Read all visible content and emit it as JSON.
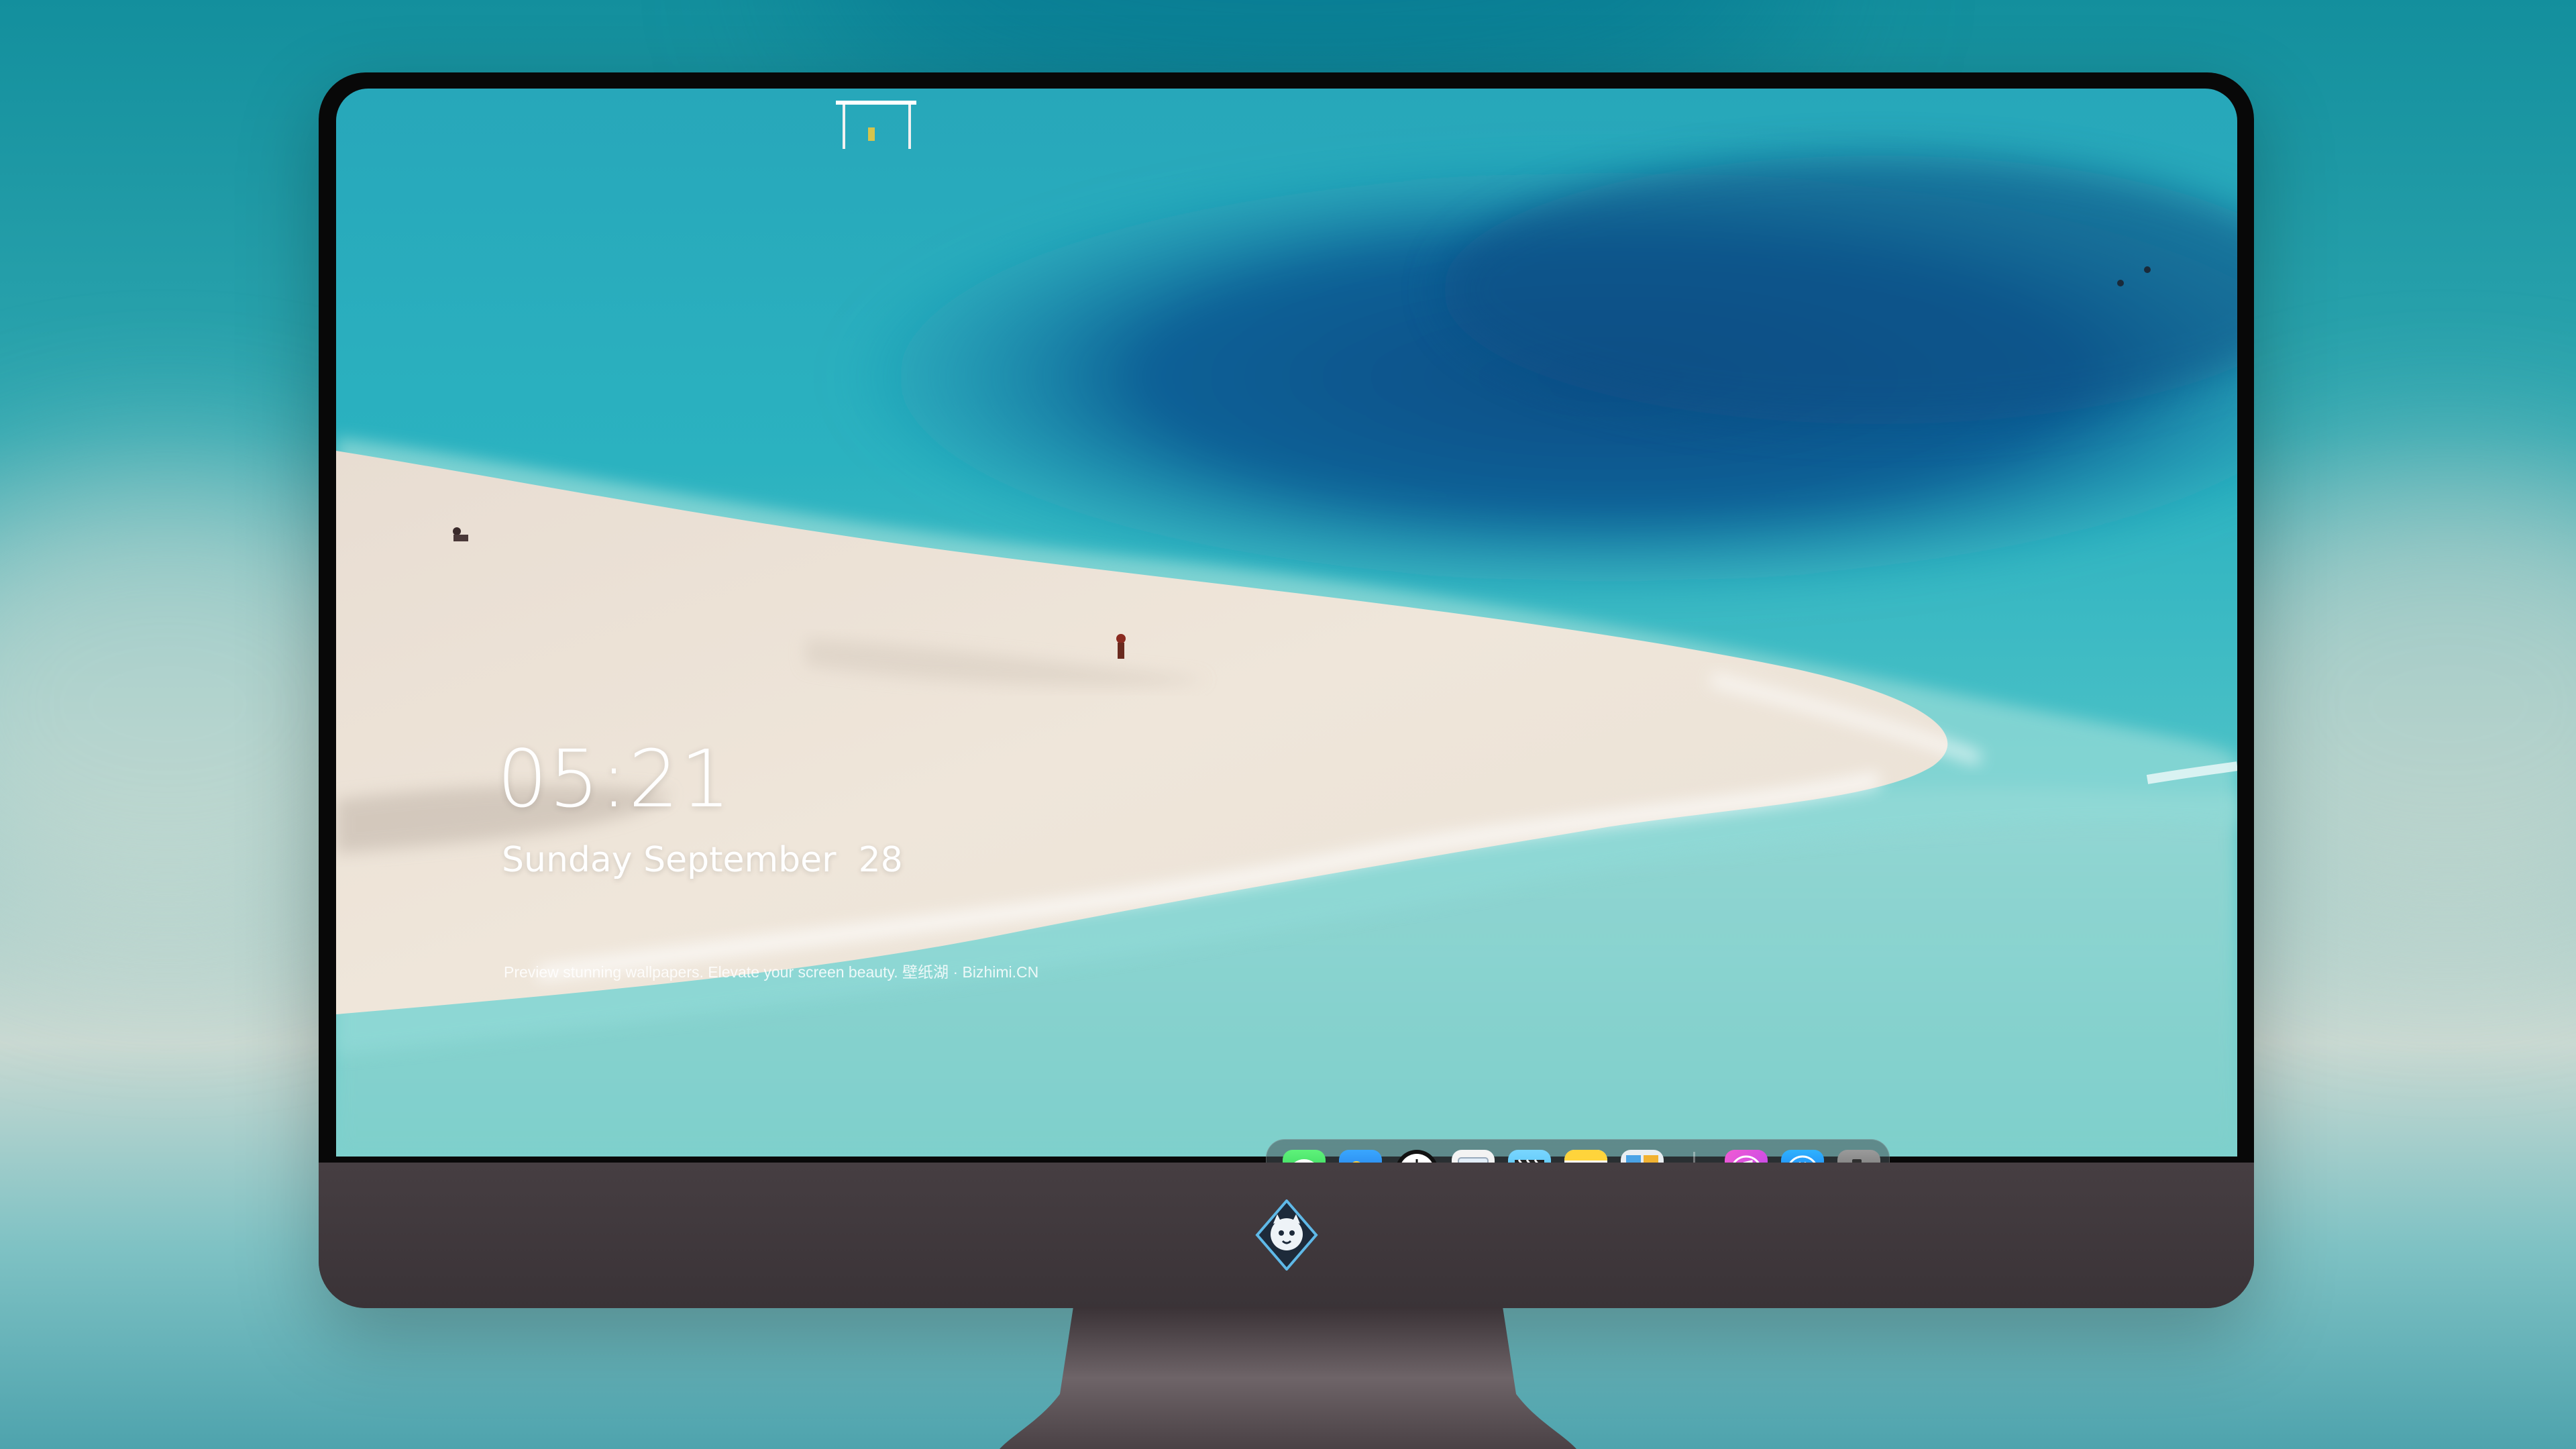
{
  "lock_screen": {
    "time": "05:21",
    "date": "Sunday September  28",
    "tagline": "Preview stunning wallpapers. Elevate your screen beauty. 壁纸湖 · Bizhimi.CN"
  },
  "dock": {
    "apps": [
      {
        "name": "Messages",
        "icon": "messages-icon",
        "color": "#2fd158"
      },
      {
        "name": "Weather",
        "icon": "weather-icon",
        "color": "#1e8ff0"
      },
      {
        "name": "Clock",
        "icon": "clock-icon",
        "color": "#111111"
      },
      {
        "name": "Preview",
        "icon": "preview-icon",
        "color": "#f0f0f0"
      },
      {
        "name": "Clips",
        "icon": "clapperboard-icon",
        "color": "#5fc9f5"
      },
      {
        "name": "Notes",
        "icon": "notes-icon",
        "color": "#ffd52e"
      },
      {
        "name": "Photo Booth",
        "icon": "photo-booth-icon",
        "color": "#e9eef2"
      },
      {
        "name": "iTunes",
        "icon": "music-note-icon",
        "color": "#d147e6"
      },
      {
        "name": "App Store",
        "icon": "app-store-icon",
        "color": "#1a8cf5"
      },
      {
        "name": "Camera",
        "icon": "camera-icon",
        "color": "#7a7a7a"
      }
    ]
  },
  "colors": {
    "sea_deep": "#0d5f8c",
    "sea_turquoise": "#2bb5c1",
    "sand": "#ede4d8",
    "monitor_body": "#3d3638"
  }
}
